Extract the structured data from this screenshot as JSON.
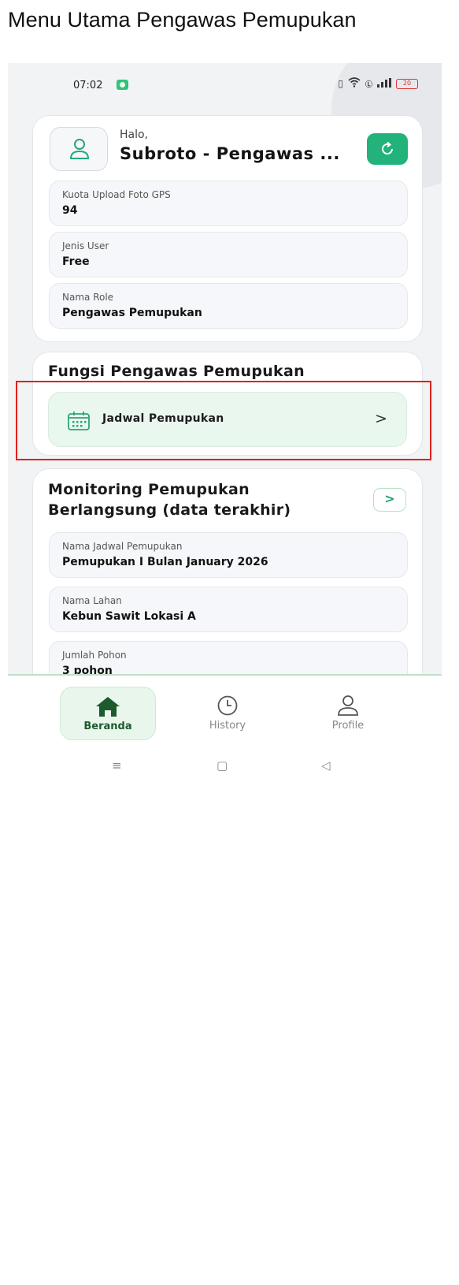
{
  "doc": {
    "title": "Menu Utama Pengawas Pemupukan"
  },
  "status_bar": {
    "time": "07:02",
    "battery": "20",
    "icons": [
      "vibrate-icon",
      "wifi-icon",
      "volte-icon",
      "signal-icon",
      "battery-icon"
    ]
  },
  "user_card": {
    "greeting": "Halo,",
    "name": "Subroto - Pengawas ...",
    "fields": [
      {
        "label": "Kuota Upload Foto GPS",
        "value": "94"
      },
      {
        "label": "Jenis User",
        "value": "Free"
      },
      {
        "label": "Nama Role",
        "value": "Pengawas Pemupukan"
      }
    ]
  },
  "fungsi_card": {
    "title": "Fungsi Pengawas Pemupukan",
    "menu": {
      "label": "Jadwal Pemupukan",
      "chevron": ">"
    }
  },
  "monitor_card": {
    "title_line1": "Monitoring Pemupukan",
    "title_line2": "Berlangsung (data terakhir)",
    "button": ">",
    "fields": [
      {
        "label": "Nama Jadwal Pemupukan",
        "value": "Pemupukan I Bulan January 2026"
      },
      {
        "label": "Nama Lahan",
        "value": "Kebun Sawit Lokasi A"
      },
      {
        "label": "Jumlah Pohon",
        "value": "3 pohon"
      }
    ]
  },
  "bottom_nav": {
    "items": [
      {
        "label": "Beranda",
        "icon": "home-icon",
        "active": true
      },
      {
        "label": "History",
        "icon": "clock-icon",
        "active": false
      },
      {
        "label": "Profile",
        "icon": "person-icon",
        "active": false
      }
    ]
  },
  "system_nav": {
    "menu": "≡",
    "home": "▢",
    "back": "◁"
  },
  "colors": {
    "accent": "#22b27a",
    "highlight": "#e0201c",
    "nav_active": "#1d5a2e"
  }
}
